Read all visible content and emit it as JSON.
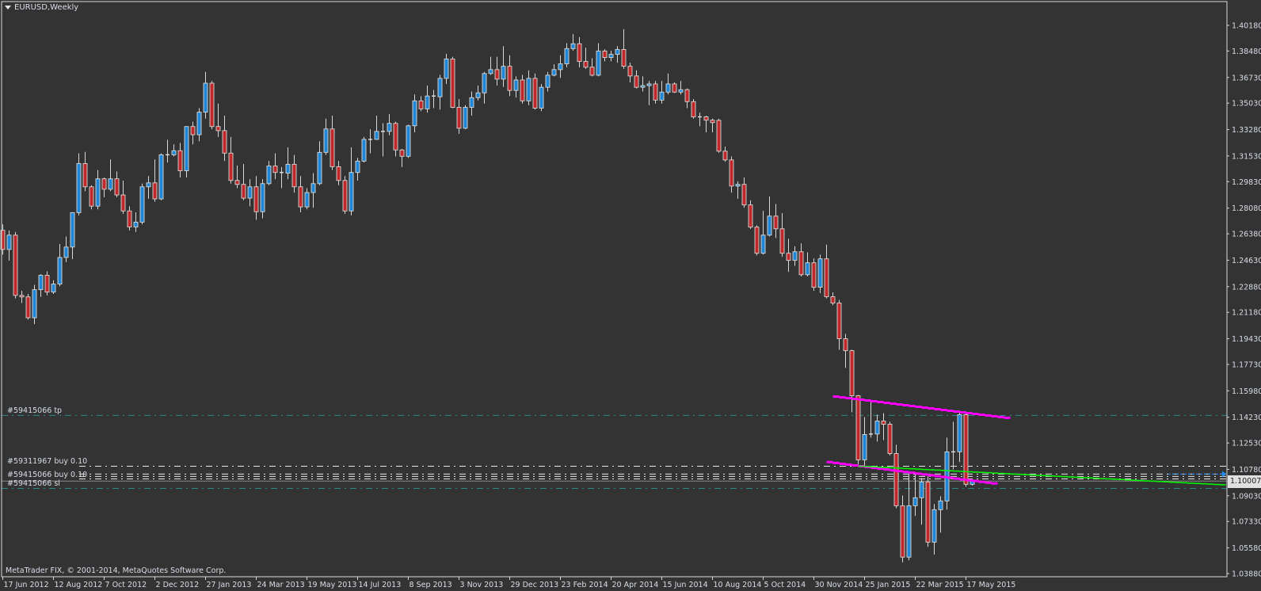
{
  "window": {
    "title": "EURUSD,Weekly",
    "menu_icon": "triangle-down-icon"
  },
  "footer": {
    "copyright": "MetaTrader FIX, © 2001-2014, MetaQuotes Software Corp."
  },
  "orders": {
    "tp_label": "#59415066 tp",
    "buy1_label": "#59311967 buy 0.10",
    "buy2_label": "#59415066 buy 0.10",
    "sl_label": "#59415066 sl"
  },
  "colors": {
    "background": "#333333",
    "bull_body": "#1f86d6",
    "bear_body": "#c0282a",
    "candle_outline": "#d8d8d8",
    "trendline": "#ff00ff",
    "indicator_line": "#00ff00",
    "tp_sl_line": "#2a8a8a",
    "order_line": "#e8e8e8",
    "ask_line": "#1e90ff",
    "bid_line": "#8a8a8a"
  },
  "chart_data": {
    "type": "candlestick",
    "symbol": "EURUSD",
    "timeframe": "Weekly",
    "ylim": [
      1.0388,
      1.4018
    ],
    "grid": false,
    "yticks": [
      "1.40180",
      "1.38480",
      "1.36730",
      "1.35030",
      "1.33280",
      "1.31530",
      "1.29830",
      "1.28080",
      "1.26380",
      "1.24630",
      "1.22880",
      "1.21180",
      "1.19430",
      "1.17730",
      "1.15980",
      "1.14230",
      "1.12530",
      "1.10780",
      "1.09030",
      "1.07330",
      "1.05580",
      "1.03880"
    ],
    "xticks": [
      "17 Jun 2012",
      "12 Aug 2012",
      "7 Oct 2012",
      "2 Dec 2012",
      "27 Jan 2013",
      "24 Mar 2013",
      "19 May 2013",
      "14 Jul 2013",
      "8 Sep 2013",
      "3 Nov 2013",
      "29 Dec 2013",
      "23 Feb 2014",
      "20 Apr 2014",
      "15 Jun 2014",
      "10 Aug 2014",
      "5 Oct 2014",
      "30 Nov 2014",
      "25 Jan 2015",
      "22 Mar 2015",
      "17 May 2015"
    ],
    "current_price": "1.10007",
    "ohlc_fields": [
      "open",
      "high",
      "low",
      "close"
    ],
    "candles": [
      [
        1.2661,
        1.27,
        1.25,
        1.2534
      ],
      [
        1.2534,
        1.266,
        1.246,
        1.2629
      ],
      [
        1.2629,
        1.265,
        1.221,
        1.223
      ],
      [
        1.223,
        1.226,
        1.218,
        1.222
      ],
      [
        1.222,
        1.224,
        1.207,
        1.2082
      ],
      [
        1.2082,
        1.23,
        1.204,
        1.2268
      ],
      [
        1.2268,
        1.237,
        1.222,
        1.2363
      ],
      [
        1.2363,
        1.239,
        1.223,
        1.2252
      ],
      [
        1.2252,
        1.233,
        1.224,
        1.2305
      ],
      [
        1.2305,
        1.257,
        1.229,
        1.2481
      ],
      [
        1.2481,
        1.262,
        1.245,
        1.255
      ],
      [
        1.255,
        1.278,
        1.247,
        1.2778
      ],
      [
        1.2778,
        1.317,
        1.276,
        1.3103
      ],
      [
        1.3103,
        1.318,
        1.292,
        1.2949
      ],
      [
        1.2949,
        1.296,
        1.28,
        1.2821
      ],
      [
        1.2821,
        1.306,
        1.28,
        1.3002
      ],
      [
        1.3002,
        1.301,
        1.288,
        1.2933
      ],
      [
        1.2933,
        1.313,
        1.292,
        1.3002
      ],
      [
        1.3002,
        1.305,
        1.288,
        1.2895
      ],
      [
        1.2895,
        1.299,
        1.277,
        1.2789
      ],
      [
        1.2789,
        1.282,
        1.266,
        1.2683
      ],
      [
        1.2683,
        1.278,
        1.265,
        1.2715
      ],
      [
        1.2715,
        1.297,
        1.27,
        1.2949
      ],
      [
        1.2949,
        1.302,
        1.287,
        1.2975
      ],
      [
        1.2975,
        1.313,
        1.285,
        1.2869
      ],
      [
        1.2869,
        1.317,
        1.286,
        1.3161
      ],
      [
        1.3161,
        1.326,
        1.311,
        1.3161
      ],
      [
        1.3161,
        1.323,
        1.315,
        1.3188
      ],
      [
        1.3188,
        1.324,
        1.301,
        1.3055
      ],
      [
        1.3055,
        1.335,
        1.301,
        1.3348
      ],
      [
        1.3348,
        1.338,
        1.323,
        1.3294
      ],
      [
        1.3294,
        1.347,
        1.325,
        1.3443
      ],
      [
        1.3443,
        1.371,
        1.34,
        1.3635
      ],
      [
        1.3635,
        1.365,
        1.333,
        1.3348
      ],
      [
        1.3348,
        1.35,
        1.328,
        1.3321
      ],
      [
        1.3321,
        1.342,
        1.312,
        1.3172
      ],
      [
        1.3172,
        1.328,
        1.297,
        1.2991
      ],
      [
        1.2991,
        1.309,
        1.294,
        1.2965
      ],
      [
        1.2965,
        1.31,
        1.286,
        1.2874
      ],
      [
        1.2874,
        1.3,
        1.282,
        1.2949
      ],
      [
        1.2949,
        1.302,
        1.273,
        1.2784
      ],
      [
        1.2784,
        1.3,
        1.274,
        1.297
      ],
      [
        1.297,
        1.312,
        1.296,
        1.3087
      ],
      [
        1.3087,
        1.317,
        1.3,
        1.3044
      ],
      [
        1.3044,
        1.308,
        1.294,
        1.3039
      ],
      [
        1.3039,
        1.321,
        1.3,
        1.3098
      ],
      [
        1.3098,
        1.316,
        1.291,
        1.2949
      ],
      [
        1.2949,
        1.302,
        1.278,
        1.2816
      ],
      [
        1.2816,
        1.294,
        1.28,
        1.2911
      ],
      [
        1.2911,
        1.304,
        1.281,
        1.297
      ],
      [
        1.297,
        1.325,
        1.296,
        1.3177
      ],
      [
        1.3177,
        1.34,
        1.316,
        1.3332
      ],
      [
        1.3332,
        1.342,
        1.306,
        1.3082
      ],
      [
        1.3082,
        1.312,
        1.296,
        1.2991
      ],
      [
        1.2991,
        1.302,
        1.277,
        1.2789
      ],
      [
        1.2789,
        1.321,
        1.276,
        1.3044
      ],
      [
        1.3044,
        1.314,
        1.299,
        1.3119
      ],
      [
        1.3119,
        1.328,
        1.311,
        1.3263
      ],
      [
        1.3263,
        1.333,
        1.317,
        1.3263
      ],
      [
        1.3263,
        1.342,
        1.326,
        1.3316
      ],
      [
        1.3316,
        1.337,
        1.315,
        1.3316
      ],
      [
        1.3316,
        1.343,
        1.329,
        1.3369
      ],
      [
        1.3369,
        1.338,
        1.315,
        1.3193
      ],
      [
        1.3193,
        1.32,
        1.308,
        1.3151
      ],
      [
        1.3151,
        1.336,
        1.314,
        1.3353
      ],
      [
        1.3353,
        1.356,
        1.331,
        1.3518
      ],
      [
        1.3518,
        1.355,
        1.345,
        1.3465
      ],
      [
        1.3465,
        1.362,
        1.344,
        1.355
      ],
      [
        1.355,
        1.359,
        1.347,
        1.3545
      ],
      [
        1.3545,
        1.369,
        1.346,
        1.3667
      ],
      [
        1.3667,
        1.383,
        1.363,
        1.3795
      ],
      [
        1.3795,
        1.381,
        1.347,
        1.3475
      ],
      [
        1.3475,
        1.353,
        1.33,
        1.3337
      ],
      [
        1.3337,
        1.349,
        1.333,
        1.3475
      ],
      [
        1.3475,
        1.358,
        1.342,
        1.3539
      ],
      [
        1.3539,
        1.362,
        1.352,
        1.3571
      ],
      [
        1.3571,
        1.371,
        1.35,
        1.3699
      ],
      [
        1.3699,
        1.381,
        1.369,
        1.3725
      ],
      [
        1.3725,
        1.381,
        1.362,
        1.3662
      ],
      [
        1.3662,
        1.388,
        1.361,
        1.3747
      ],
      [
        1.3747,
        1.382,
        1.355,
        1.3587
      ],
      [
        1.3587,
        1.368,
        1.354,
        1.3656
      ],
      [
        1.3656,
        1.369,
        1.35,
        1.3518
      ],
      [
        1.3518,
        1.372,
        1.349,
        1.3667
      ],
      [
        1.3667,
        1.37,
        1.346,
        1.347
      ],
      [
        1.347,
        1.363,
        1.345,
        1.3608
      ],
      [
        1.3608,
        1.371,
        1.358,
        1.3688
      ],
      [
        1.3688,
        1.376,
        1.368,
        1.3725
      ],
      [
        1.3725,
        1.382,
        1.367,
        1.3763
      ],
      [
        1.3763,
        1.39,
        1.374,
        1.3864
      ],
      [
        1.3864,
        1.396,
        1.385,
        1.3896
      ],
      [
        1.3896,
        1.394,
        1.374,
        1.3779
      ],
      [
        1.3779,
        1.387,
        1.373,
        1.3741
      ],
      [
        1.3741,
        1.38,
        1.368,
        1.3688
      ],
      [
        1.3688,
        1.39,
        1.368,
        1.3848
      ],
      [
        1.3848,
        1.386,
        1.378,
        1.3805
      ],
      [
        1.3805,
        1.385,
        1.378,
        1.3826
      ],
      [
        1.3826,
        1.388,
        1.377,
        1.3858
      ],
      [
        1.3858,
        1.3993,
        1.373,
        1.3747
      ],
      [
        1.3747,
        1.377,
        1.364,
        1.3683
      ],
      [
        1.3683,
        1.372,
        1.36,
        1.3608
      ],
      [
        1.3608,
        1.368,
        1.358,
        1.3619
      ],
      [
        1.3619,
        1.365,
        1.349,
        1.363
      ],
      [
        1.363,
        1.365,
        1.35,
        1.3523
      ],
      [
        1.3523,
        1.365,
        1.35,
        1.3576
      ],
      [
        1.3576,
        1.37,
        1.356,
        1.363
      ],
      [
        1.363,
        1.364,
        1.357,
        1.3576
      ],
      [
        1.3576,
        1.365,
        1.356,
        1.3592
      ],
      [
        1.3592,
        1.36,
        1.347,
        1.3513
      ],
      [
        1.3513,
        1.353,
        1.34,
        1.3412
      ],
      [
        1.3412,
        1.344,
        1.335,
        1.3412
      ],
      [
        1.3412,
        1.342,
        1.331,
        1.339
      ],
      [
        1.339,
        1.34,
        1.331,
        1.3374
      ],
      [
        1.3389,
        1.34,
        1.3175,
        1.3185
      ],
      [
        1.3185,
        1.3215,
        1.3115,
        1.3127
      ],
      [
        1.3127,
        1.315,
        1.291,
        1.2954
      ],
      [
        1.2954,
        1.2985,
        1.287,
        1.2965
      ],
      [
        1.2965,
        1.301,
        1.281,
        1.2829
      ],
      [
        1.2829,
        1.286,
        1.267,
        1.2682
      ],
      [
        1.2682,
        1.2695,
        1.2495,
        1.2509
      ],
      [
        1.2509,
        1.279,
        1.25,
        1.2629
      ],
      [
        1.2629,
        1.2885,
        1.262,
        1.2755
      ],
      [
        1.2755,
        1.2835,
        1.261,
        1.2671
      ],
      [
        1.2671,
        1.2775,
        1.2485,
        1.2509
      ],
      [
        1.2509,
        1.2605,
        1.2385,
        1.2462
      ],
      [
        1.2462,
        1.2555,
        1.2425,
        1.2519
      ],
      [
        1.2519,
        1.2575,
        1.2355,
        1.2367
      ],
      [
        1.2367,
        1.2515,
        1.2355,
        1.2446
      ],
      [
        1.2446,
        1.2475,
        1.226,
        1.2284
      ],
      [
        1.2284,
        1.25,
        1.2245,
        1.2472
      ],
      [
        1.2472,
        1.2567,
        1.221,
        1.2221
      ],
      [
        1.2221,
        1.225,
        1.2165,
        1.2179
      ],
      [
        1.2179,
        1.22,
        1.187,
        1.1943
      ],
      [
        1.1943,
        1.1975,
        1.175,
        1.1864
      ],
      [
        1.1864,
        1.187,
        1.1456,
        1.1566
      ],
      [
        1.1566,
        1.157,
        1.111,
        1.1141
      ],
      [
        1.1141,
        1.1424,
        1.1099,
        1.1309
      ],
      [
        1.1309,
        1.1534,
        1.1288,
        1.1312
      ],
      [
        1.1312,
        1.144,
        1.1262,
        1.1398
      ],
      [
        1.1398,
        1.145,
        1.1272,
        1.1377
      ],
      [
        1.1377,
        1.1393,
        1.117,
        1.1183
      ],
      [
        1.1183,
        1.1241,
        1.082,
        1.0837
      ],
      [
        1.0837,
        1.0905,
        1.0462,
        1.0497
      ],
      [
        1.0497,
        1.1052,
        1.0475,
        1.0837
      ],
      [
        1.0837,
        1.105,
        1.0769,
        1.089
      ],
      [
        1.089,
        1.102,
        1.0712,
        1.0995
      ],
      [
        1.0995,
        1.1031,
        1.0565,
        1.0596
      ],
      [
        1.0596,
        1.0848,
        1.0513,
        1.0811
      ],
      [
        1.0811,
        1.09,
        1.0659,
        1.0869
      ],
      [
        1.0869,
        1.1288,
        1.0811,
        1.1194
      ],
      [
        1.1194,
        1.1393,
        1.1078,
        1.1194
      ],
      [
        1.1194,
        1.1466,
        1.1126,
        1.144
      ],
      [
        1.144,
        1.146,
        1.0963,
        1.0979
      ],
      [
        1.0979,
        1.1006,
        1.097,
        1.1001
      ]
    ],
    "trendlines": [
      {
        "from": [
          "2014-12-21",
          1.156
        ],
        "to": [
          "2015-07-05",
          1.1414
        ],
        "color": "#ff00ff"
      },
      {
        "from": [
          "2014-12-14",
          1.1126
        ],
        "to": [
          "2015-06-21",
          1.0979
        ],
        "color": "#ff00ff"
      }
    ],
    "indicator_line": {
      "from": [
        "2015-01-18",
        1.1099
      ],
      "to": [
        "2016-02-28",
        1.0974
      ],
      "color": "#00ff00"
    },
    "order_levels": {
      "tp": 1.1435,
      "buy1": 1.1099,
      "buy_group": [
        1.1047,
        1.1031,
        1.1015
      ],
      "sl": 1.0952,
      "bid": 1.10007,
      "ask": 1.1047
    }
  }
}
